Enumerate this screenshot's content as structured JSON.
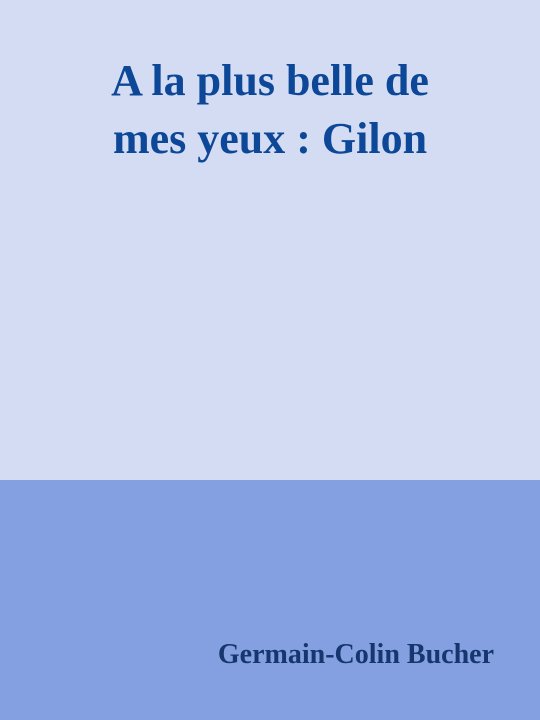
{
  "cover": {
    "title_line1": "A la plus belle de",
    "title_line2": "mes yeux : Gilon",
    "author": "Germain-Colin Bucher"
  },
  "colors": {
    "top_background": "#d4dcf4",
    "bottom_background": "#84a0e0",
    "title_color": "#0d4797",
    "author_color": "#16366e"
  }
}
